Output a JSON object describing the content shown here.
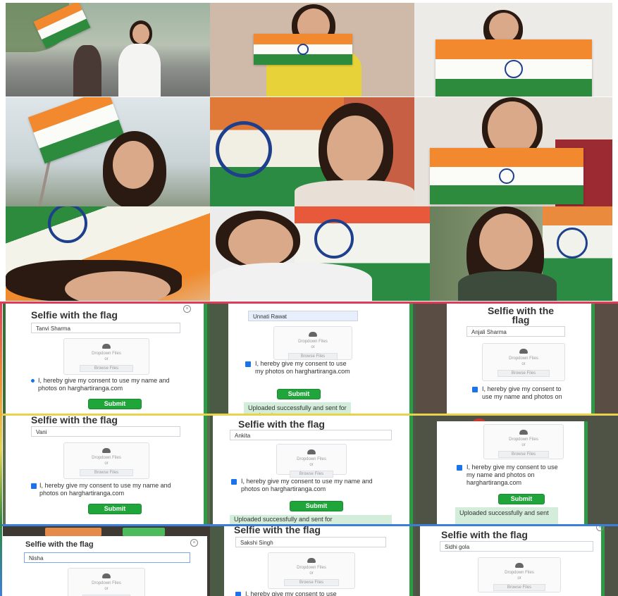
{
  "forms": [
    {
      "title": "Selfie with the flag",
      "name": "Tanvi Sharma",
      "consent": "I, hereby give my consent to use my name and photos on harghartiranga.com",
      "submit": "Submit"
    },
    {
      "title": "",
      "name": "Unnati Rawat",
      "consent": "I, hereby give my consent to use my photos on harghartiranga.com",
      "submit": "Submit",
      "success": "Uploaded successfully and sent for moderation"
    },
    {
      "title": "Selfie with the flag",
      "name": "Anjali Sharma",
      "consent": "I, hereby give my consent to use my name and photos on",
      "submit": ""
    },
    {
      "title": "Selfie with the flag",
      "name": "Vani",
      "consent": "I, hereby give my consent to use my name and photos on harghartiranga.com",
      "submit": "Submit"
    },
    {
      "title": "Selfie with the flag",
      "name": "Ankita",
      "consent": "I, hereby give my consent to use my name and photos on harghartiranga.com",
      "submit": "Submit",
      "success": "Uploaded successfully and sent for"
    },
    {
      "title": "",
      "name": "",
      "consent": "I, hereby give my consent to use my name and photos on harghartiranga.com",
      "submit": "Submit",
      "success": "Uploaded successfully and sent"
    },
    {
      "title": "Selfie with the flag",
      "name": "Nisha",
      "consent": "",
      "submit": ""
    },
    {
      "title": "Selfie with the flag",
      "name": "Sakshi Singh",
      "consent": "I, hereby give my consent to use",
      "submit": ""
    },
    {
      "title": "Selfie with the flag",
      "name": "Sidhi gola",
      "consent": "",
      "submit": ""
    }
  ],
  "dropzone": {
    "label": "Dropdown Files",
    "or": "or",
    "browse": "Browse Files"
  },
  "icons": {
    "upload": "cloud-upload-icon",
    "close": "close-icon",
    "checkbox": "checkbox-checked-icon"
  },
  "colors": {
    "saffron": "#f2892e",
    "white": "#fbfbf7",
    "green": "#2c8b3c",
    "chakra": "#1d3f8c",
    "submit": "#1fa53a",
    "success_bg": "#d4edda",
    "divider_red": "#e23b5a",
    "divider_yellow": "#e8d44a",
    "divider_blue": "#3d7fd8"
  }
}
